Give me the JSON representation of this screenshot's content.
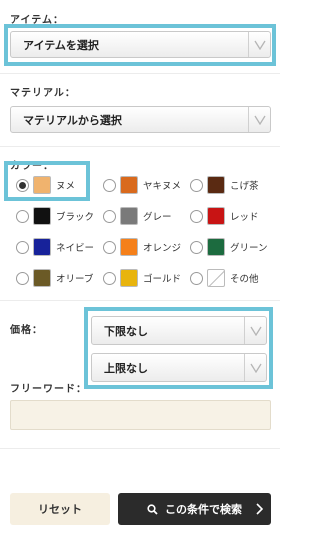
{
  "item": {
    "label": "アイテム：",
    "value": "アイテムを選択"
  },
  "material": {
    "label": "マテリアル：",
    "value": "マテリアルから選択"
  },
  "color": {
    "label": "カラー：",
    "options": [
      {
        "name": "ヌメ",
        "swatch": "#f0b36e",
        "checked": true
      },
      {
        "name": "ヤキヌメ",
        "swatch": "#d96a1d",
        "checked": false
      },
      {
        "name": "こげ茶",
        "swatch": "#5a2a12",
        "checked": false
      },
      {
        "name": "ブラック",
        "swatch": "#111111",
        "checked": false
      },
      {
        "name": "グレー",
        "swatch": "#7a7a7a",
        "checked": false
      },
      {
        "name": "レッド",
        "swatch": "#c81414",
        "checked": false
      },
      {
        "name": "ネイビー",
        "swatch": "#17229a",
        "checked": false
      },
      {
        "name": "オレンジ",
        "swatch": "#f5801a",
        "checked": false
      },
      {
        "name": "グリーン",
        "swatch": "#1c6b3f",
        "checked": false
      },
      {
        "name": "オリーブ",
        "swatch": "#6b5a26",
        "checked": false
      },
      {
        "name": "ゴールド",
        "swatch": "#e8b40d",
        "checked": false
      },
      {
        "name": "その他",
        "swatch": "#ffffff",
        "checked": false
      }
    ]
  },
  "price": {
    "label": "価格：",
    "min": "下限なし",
    "max": "上限なし"
  },
  "freeword": {
    "label": "フリーワード：",
    "value": ""
  },
  "buttons": {
    "reset": "リセット",
    "search": "この条件で検索"
  },
  "colors": {
    "highlight": "#6cc3d8",
    "field_bg": "#f7f2e6",
    "search_bg": "#2b2b2b"
  }
}
